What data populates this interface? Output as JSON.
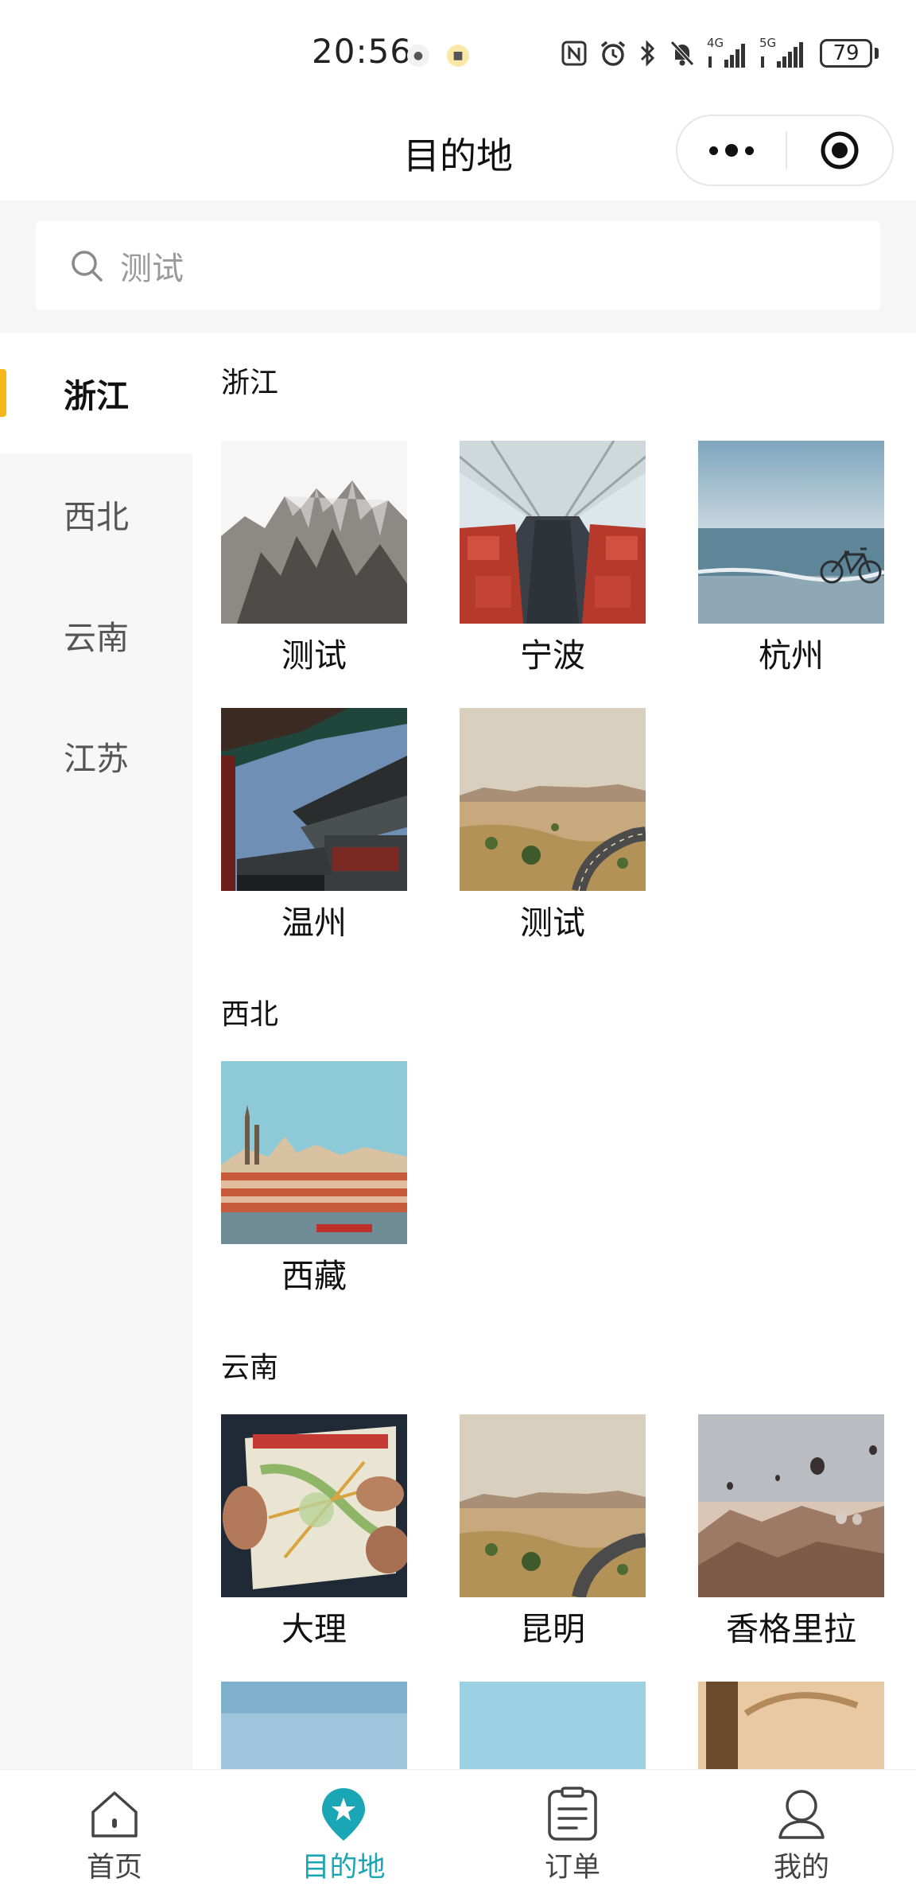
{
  "status_bar": {
    "time": "20:56",
    "network_1": "4G",
    "network_2": "5G",
    "battery": "79"
  },
  "nav": {
    "title": "目的地"
  },
  "search": {
    "placeholder": "测试"
  },
  "sidebar": {
    "items": [
      {
        "label": "浙江",
        "active": true
      },
      {
        "label": "西北",
        "active": false
      },
      {
        "label": "云南",
        "active": false
      },
      {
        "label": "江苏",
        "active": false
      }
    ]
  },
  "sections": [
    {
      "title": "浙江",
      "cards": [
        {
          "label": "测试",
          "image": "mountain-peaks-image"
        },
        {
          "label": "宁波",
          "image": "train-interior-image"
        },
        {
          "label": "杭州",
          "image": "beach-bicycle-image"
        },
        {
          "label": "温州",
          "image": "pagoda-roof-image"
        },
        {
          "label": "测试",
          "image": "desert-road-image"
        }
      ]
    },
    {
      "title": "西北",
      "cards": [
        {
          "label": "西藏",
          "image": "castle-city-image"
        }
      ]
    },
    {
      "title": "云南",
      "cards": [
        {
          "label": "大理",
          "image": "hands-map-image"
        },
        {
          "label": "昆明",
          "image": "desert-road-image"
        },
        {
          "label": "香格里拉",
          "image": "hot-air-balloons-image"
        }
      ]
    }
  ],
  "tabs": [
    {
      "label": "首页",
      "icon": "home-icon",
      "active": false
    },
    {
      "label": "目的地",
      "icon": "location-star-icon",
      "active": true
    },
    {
      "label": "订单",
      "icon": "order-clipboard-icon",
      "active": false
    },
    {
      "label": "我的",
      "icon": "user-icon",
      "active": false
    }
  ],
  "colors": {
    "accent_teal": "#1aa6b4",
    "indicator_yellow": "#f5b719"
  }
}
